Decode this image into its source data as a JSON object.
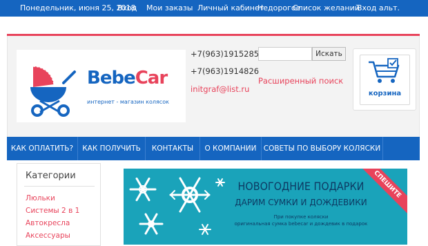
{
  "topbar": {
    "date": "Понедельник, июня 25, 2018",
    "login": "Вход",
    "orders": "Мои заказы",
    "account": "Личный кабинет",
    "cheap": "Недорогое",
    "wishlist": "Список желаний",
    "alt_login": "Вход альт."
  },
  "logo": {
    "name_part1": "Bebe",
    "name_part2": "Car",
    "subtitle": "интернет - магазин колясок"
  },
  "contacts": {
    "phone1": "+7(963)1915285",
    "phone2": "+7(963)1914826",
    "email": "initgraf@list.ru"
  },
  "search": {
    "value": "",
    "button": "Искать",
    "advanced": "Расширенный поиск"
  },
  "cart": {
    "label": "корзина"
  },
  "nav": {
    "items": [
      "КАК ОПЛАТИТЬ?",
      "КАК ПОЛУЧИТЬ",
      "КОНТАКТЫ",
      "О КОМПАНИИ",
      "СОВЕТЫ ПО ВЫБОРУ КОЛЯСКИ"
    ]
  },
  "categories": {
    "title": "Категории",
    "items": [
      "Люльки",
      "Системы 2 в 1",
      "Автокресла",
      "Аксессуары"
    ]
  },
  "banner": {
    "title": "НОВОГОДНИЕ ПОДАРКИ",
    "subtitle": "ДАРИМ СУМКИ И ДОЖДЕВИКИ",
    "line1": "При покупке коляски",
    "line2": "оригинальная сумка bebecar и дождевик в подарок",
    "ribbon": "СПЕШИТЕ"
  },
  "colors": {
    "primary": "#1565c0",
    "accent": "#e8435b",
    "banner": "#1aa3ba"
  }
}
